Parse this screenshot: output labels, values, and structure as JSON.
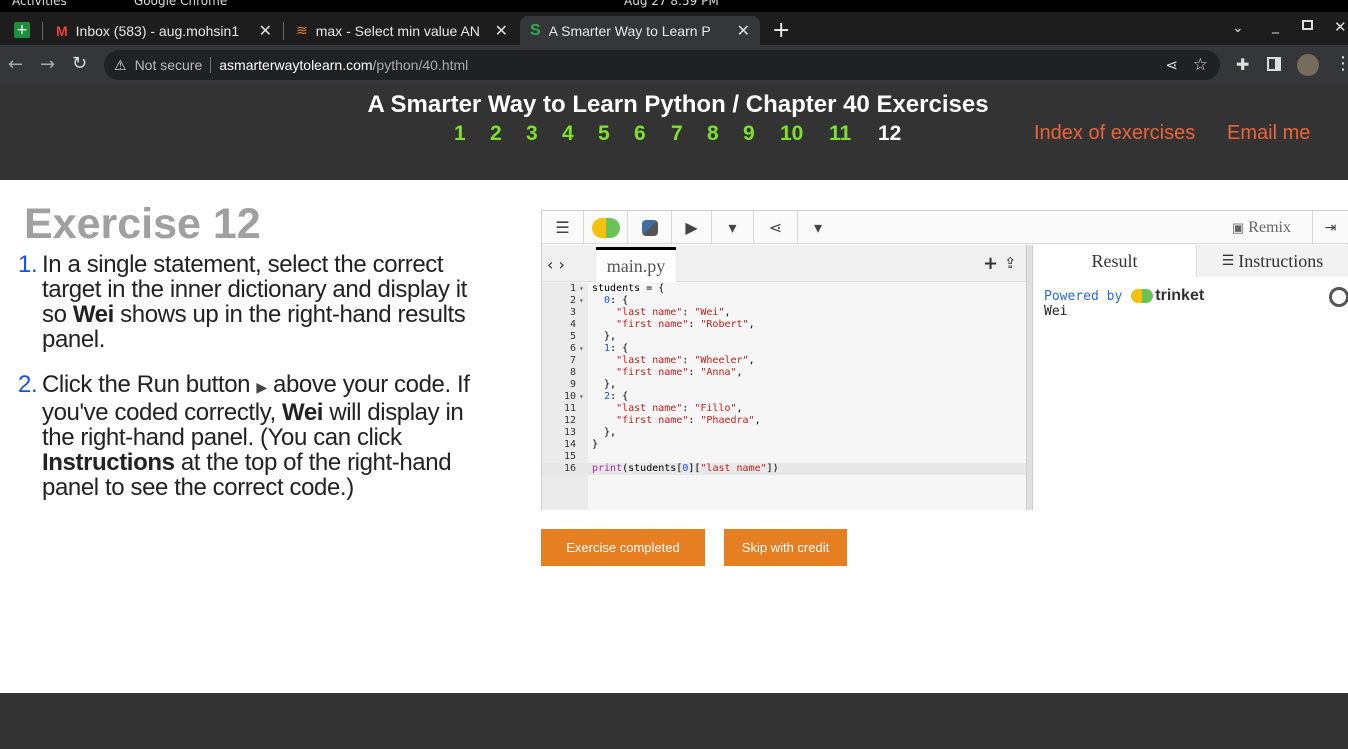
{
  "os": {
    "activities": "Activities",
    "app": "Google Chrome",
    "clock": "Aug 27  8:59 PM"
  },
  "tabs": [
    {
      "title": "Inbox (583) - aug.mohsin1",
      "favicon": "gmail-icon"
    },
    {
      "title": "max - Select min value AN",
      "favicon": "stackoverflow-icon"
    },
    {
      "title": "A Smarter Way to Learn P",
      "favicon": "smarterway-icon"
    }
  ],
  "address": {
    "security": "Not secure",
    "host": "asmarterwaytolearn.com",
    "path": "/python/40.html"
  },
  "header": {
    "title": "A Smarter Way to Learn Python / Chapter 40 Exercises",
    "chapters": [
      "1",
      "2",
      "3",
      "4",
      "5",
      "6",
      "7",
      "8",
      "9",
      "10",
      "11",
      "12"
    ],
    "current": "12",
    "index_link": "Index of exercises",
    "email_link": "Email me"
  },
  "exercise": {
    "heading": "Exercise 12",
    "step1": {
      "num": "1.",
      "a": "In a single statement, select the correct target in the inner dictionary and display it so ",
      "b": "Wei",
      "c": " shows up in the right-hand results panel."
    },
    "step2": {
      "num": "2.",
      "a": "Click the Run button ",
      "arrow": "▶",
      "b": " above your code. If you've coded correctly, ",
      "c": "Wei",
      "d": " will display in the right-hand panel. (You can click ",
      "e": "Instructions",
      "f": " at the top of the right-hand panel to see the correct code.)"
    }
  },
  "trinket": {
    "remix": "Remix",
    "file": "main.py",
    "result_tab": "Result",
    "instructions_tab": "Instructions",
    "powered_by": "Powered by",
    "brand": "trinket",
    "output": "Wei",
    "code_lines": [
      "students = {",
      "  0: {",
      "    \"last name\": \"Wei\",",
      "    \"first name\": \"Robert\",",
      "  },",
      "  1: {",
      "    \"last name\": \"Wheeler\",",
      "    \"first name\": \"Anna\",",
      "  },",
      "  2: {",
      "    \"last name\": \"Fillo\",",
      "    \"first name\": \"Phaedra\",",
      "  },",
      "}",
      "",
      "print(students[0][\"last name\"])"
    ]
  },
  "buttons": {
    "completed": "Exercise completed",
    "skip": "Skip with credit"
  },
  "colors": {
    "header_bg": "#333333",
    "chapter_link": "#7fe12d",
    "accent_link": "#e8663a",
    "button": "#e67e22"
  }
}
